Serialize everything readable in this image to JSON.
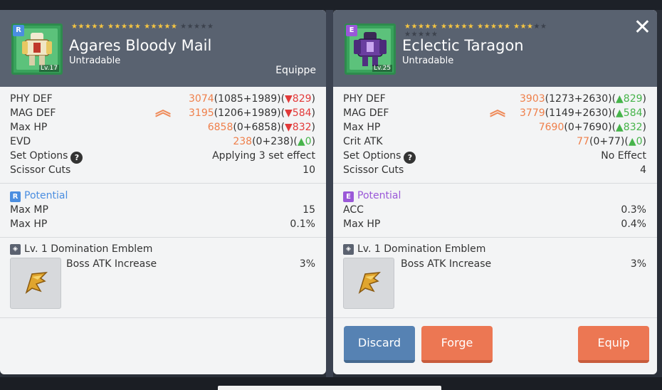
{
  "left": {
    "grade": "R",
    "level": "Lv.17",
    "stars_on": 15,
    "stars_total": 20,
    "name": "Agares Bloody Mail",
    "tradable": "Untradable",
    "equipped": "Equippe",
    "stats": [
      {
        "label": "PHY DEF",
        "total": "3074",
        "breakdown": "(1085+1989)(",
        "diff": "▼829",
        "close": ")"
      },
      {
        "label": "MAG DEF",
        "total": "3195",
        "breakdown": "(1206+1989)(",
        "diff": "▼584",
        "close": ")"
      },
      {
        "label": "Max HP",
        "total": "6858",
        "breakdown": "(0+6858)(",
        "diff": "▼832",
        "close": ")"
      },
      {
        "label": "EVD",
        "total": "238",
        "breakdown": "(0+238)(",
        "diff": "▲0",
        "close": ")"
      }
    ],
    "set_options": {
      "label": "Set Options",
      "value": "Applying 3 set effect"
    },
    "scissor": {
      "label": "Scissor Cuts",
      "value": "10"
    },
    "potential": {
      "title": "Potential",
      "rows": [
        {
          "label": "Max MP",
          "value": "15"
        },
        {
          "label": "Max HP",
          "value": "0.1%"
        }
      ]
    },
    "emblem": {
      "title": "Lv. 1 Domination Emblem",
      "effect": "Boss ATK Increase",
      "value": "3%"
    }
  },
  "right": {
    "grade": "E",
    "level": "Lv.25",
    "stars_on": 18,
    "stars_total": 25,
    "name": "Eclectic Taragon",
    "tradable": "Untradable",
    "stats": [
      {
        "label": "PHY DEF",
        "total": "3903",
        "breakdown": "(1273+2630)(",
        "diff": "▲829",
        "close": ")"
      },
      {
        "label": "MAG DEF",
        "total": "3779",
        "breakdown": "(1149+2630)(",
        "diff": "▲584",
        "close": ")"
      },
      {
        "label": "Max HP",
        "total": "7690",
        "breakdown": "(0+7690)(",
        "diff": "▲832",
        "close": ")"
      },
      {
        "label": "Crit ATK",
        "total": "77",
        "breakdown": "(0+77)(",
        "diff": "▲0",
        "close": ")"
      }
    ],
    "set_options": {
      "label": "Set Options",
      "value": "No Effect"
    },
    "scissor": {
      "label": "Scissor Cuts",
      "value": "4"
    },
    "potential": {
      "title": "Potential",
      "rows": [
        {
          "label": "ACC",
          "value": "0.3%"
        },
        {
          "label": "Max HP",
          "value": "0.4%"
        }
      ]
    },
    "emblem": {
      "title": "Lv. 1 Domination Emblem",
      "effect": "Boss ATK Increase",
      "value": "3%"
    },
    "buttons": {
      "discard": "Discard",
      "forge": "Forge",
      "equip": "Equip"
    }
  },
  "icons": {
    "close": "close-icon",
    "help": "question-icon",
    "compare": "double-chevron-up-icon",
    "emblem": "emblem-icon"
  },
  "colors": {
    "header": "#596270",
    "accent_orange": "#ef7f4a",
    "down_red": "#e23a3a",
    "up_green": "#46b44a",
    "potential_r": "#4b8ee0",
    "potential_e": "#9a58d8"
  }
}
